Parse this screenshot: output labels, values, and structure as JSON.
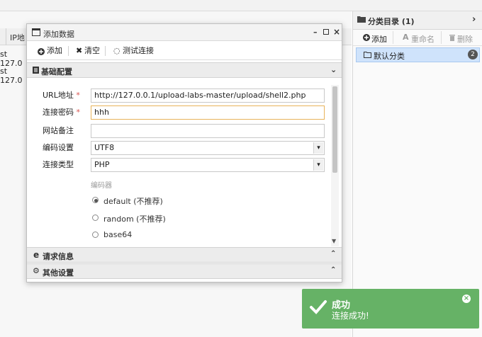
{
  "background": {
    "ip_header": "IP地",
    "rows": [
      "st 127.0",
      "st 127.0"
    ]
  },
  "category_panel": {
    "title": "分类目录 (1)",
    "add_label": "添加",
    "rename_label": "重命名",
    "delete_label": "删除",
    "item_label": "默认分类",
    "item_count": "2"
  },
  "dialog": {
    "title": "添加数据",
    "toolbar": {
      "add": "添加",
      "clear": "清空",
      "test": "测试连接"
    },
    "section_basic": "基础配置",
    "fields": {
      "url_label": "URL地址",
      "url_value": "http://127.0.0.1/upload-labs-master/upload/shell2.php",
      "password_label": "连接密码",
      "password_value": "hhh",
      "note_label": "网站备注",
      "note_value": "",
      "encoding_label": "编码设置",
      "encoding_value": "UTF8",
      "type_label": "连接类型",
      "type_value": "PHP",
      "encoder_label": "编码器",
      "required_mark": "*"
    },
    "encoders": [
      "default (不推荐)",
      "random (不推荐)",
      "base64"
    ],
    "encoder_selected": 0,
    "section_request": "请求信息",
    "section_other": "其他设置"
  },
  "toast": {
    "title": "成功",
    "message": "连接成功!",
    "color": "#66b266"
  }
}
